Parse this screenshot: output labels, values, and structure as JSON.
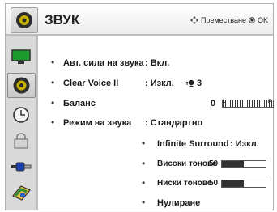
{
  "header": {
    "title": "ЗВУК",
    "hint": "Преместване",
    "hint_ok": "OK",
    "move_icon": "four-way-arrow-icon",
    "ok_icon": "ok-circle-icon"
  },
  "sidebar": {
    "items": [
      {
        "name": "picture-icon",
        "selected": false
      },
      {
        "name": "sound-icon",
        "selected": true
      },
      {
        "name": "time-icon",
        "selected": false
      },
      {
        "name": "lock-icon",
        "selected": false
      },
      {
        "name": "input-icon",
        "selected": false
      },
      {
        "name": "options-icon",
        "selected": false
      }
    ]
  },
  "menu": {
    "auto_volume": {
      "label": "Авт. сила на звука",
      "value": ": Вкл."
    },
    "clear_voice": {
      "label": "Clear Voice II",
      "value": ": Изкл.",
      "level": "3"
    },
    "balance": {
      "label": "Баланс",
      "value": "0",
      "left": "L",
      "right": "R"
    },
    "sound_mode": {
      "label": "Режим на звука",
      "value": ": Стандартно"
    },
    "infinite_surround": {
      "label": "Infinite Surround",
      "value": ": Изкл."
    },
    "treble": {
      "label": "Високи тонове",
      "value": "50",
      "level": 0.5
    },
    "bass": {
      "label": "Ниски тонове",
      "value": "50",
      "level": 0.5
    },
    "reset": {
      "label": "Нулиране"
    }
  },
  "colors": {
    "accent": "#333333",
    "sidebar": "#d9d9d9"
  }
}
